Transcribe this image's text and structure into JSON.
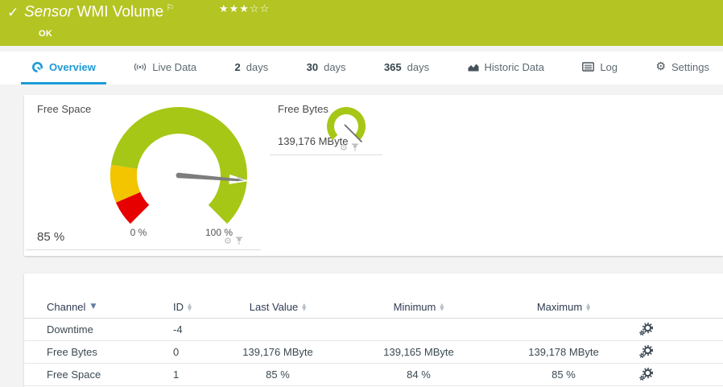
{
  "colors": {
    "status_ok_green": "#b4c423",
    "accent_blue": "#1b9ad6",
    "gauge_green": "#a6c716",
    "gauge_yellow": "#f2c500",
    "gauge_red": "#e60000"
  },
  "header": {
    "check_glyph": "✓",
    "type_label": "Sensor",
    "title": "WMI Volume",
    "flag_glyph": "⚐",
    "stars_filled": "★★★",
    "stars_empty": "☆☆",
    "status": "OK"
  },
  "tabs": {
    "overview": {
      "label": "Overview"
    },
    "live_data": {
      "label": "Live Data"
    },
    "days2": {
      "num": "2",
      "unit": "days"
    },
    "days30": {
      "num": "30",
      "unit": "days"
    },
    "days365": {
      "num": "365",
      "unit": "days"
    },
    "historic": {
      "label": "Historic Data"
    },
    "log": {
      "label": "Log"
    },
    "settings": {
      "label": "Settings"
    }
  },
  "icons": {
    "gear_glyph": "⚙"
  },
  "free_space": {
    "title": "Free Space",
    "value": "85 %",
    "axis_min": "0 %",
    "axis_max": "100 %",
    "unit": "%",
    "needle_percent": 85
  },
  "free_bytes": {
    "title": "Free Bytes",
    "value": "139,176 MByte"
  },
  "table": {
    "col_channel": "Channel",
    "col_id": "ID",
    "col_last": "Last Value",
    "col_min": "Minimum",
    "col_max": "Maximum",
    "rows": [
      {
        "channel": "Downtime",
        "id": "-4",
        "last": "",
        "min": "",
        "max": ""
      },
      {
        "channel": "Free Bytes",
        "id": "0",
        "last": "139,176 MByte",
        "min": "139,165 MByte",
        "max": "139,178 MByte"
      },
      {
        "channel": "Free Space",
        "id": "1",
        "last": "85 %",
        "min": "84 %",
        "max": "85 %"
      }
    ]
  }
}
